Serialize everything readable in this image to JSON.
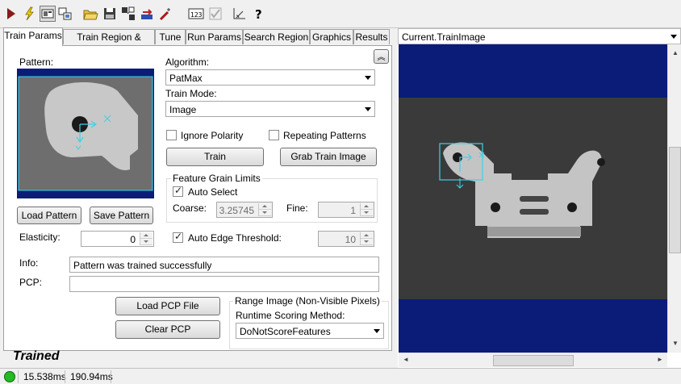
{
  "toolbar": {
    "buttons": [
      {
        "icon": "run-icon"
      },
      {
        "icon": "lightning-icon"
      },
      {
        "icon": "image-view-icon"
      },
      {
        "icon": "graphics-icon"
      },
      {
        "icon": "open-folder-icon"
      },
      {
        "icon": "save-icon"
      },
      {
        "icon": "load-image-icon"
      },
      {
        "icon": "reset-icon"
      },
      {
        "icon": "wand-icon"
      },
      {
        "icon": "numeric-icon"
      },
      {
        "icon": "check-icon"
      },
      {
        "icon": "measure-icon"
      },
      {
        "icon": "help-icon"
      }
    ]
  },
  "tabs": [
    "Train Params",
    "Train Region & Origin",
    "Tune",
    "Run Params",
    "Search Region",
    "Graphics",
    "Results"
  ],
  "left": {
    "pattern_label": "Pattern:",
    "algorithm_label": "Algorithm:",
    "algorithm_value": "PatMax",
    "train_mode_label": "Train Mode:",
    "train_mode_value": "Image",
    "ignore_polarity_label": "Ignore Polarity",
    "ignore_polarity_checked": false,
    "repeating_patterns_label": "Repeating Patterns",
    "repeating_patterns_checked": false,
    "train_button": "Train",
    "grab_train_image_button": "Grab Train Image",
    "feature_grain_title": "Feature Grain Limits",
    "auto_select_label": "Auto Select",
    "auto_select_checked": true,
    "coarse_label": "Coarse:",
    "coarse_value": "3.25745",
    "fine_label": "Fine:",
    "fine_value": "1",
    "load_pattern_button": "Load Pattern",
    "save_pattern_button": "Save Pattern",
    "elasticity_label": "Elasticity:",
    "elasticity_value": "0",
    "auto_edge_label": "Auto Edge Threshold:",
    "auto_edge_checked": true,
    "auto_edge_value": "10",
    "info_label": "Info:",
    "info_value": "Pattern was trained successfully",
    "pcp_label": "PCP:",
    "pcp_value": "",
    "load_pcp_button": "Load PCP File",
    "clear_pcp_button": "Clear PCP",
    "range_image_title": "Range Image (Non-Visible Pixels)",
    "runtime_scoring_label": "Runtime Scoring Method:",
    "runtime_scoring_value": "DoNotScoreFeatures",
    "trained_status": "Trained"
  },
  "right": {
    "image_selector_value": "Current.TrainImage"
  },
  "status": {
    "time1": "15.538ms",
    "time2": "190.94ms",
    "indicator_color": "#22bb22"
  },
  "colors": {
    "image_frame": "#0a1c78",
    "selection": "#3cd2e6"
  }
}
